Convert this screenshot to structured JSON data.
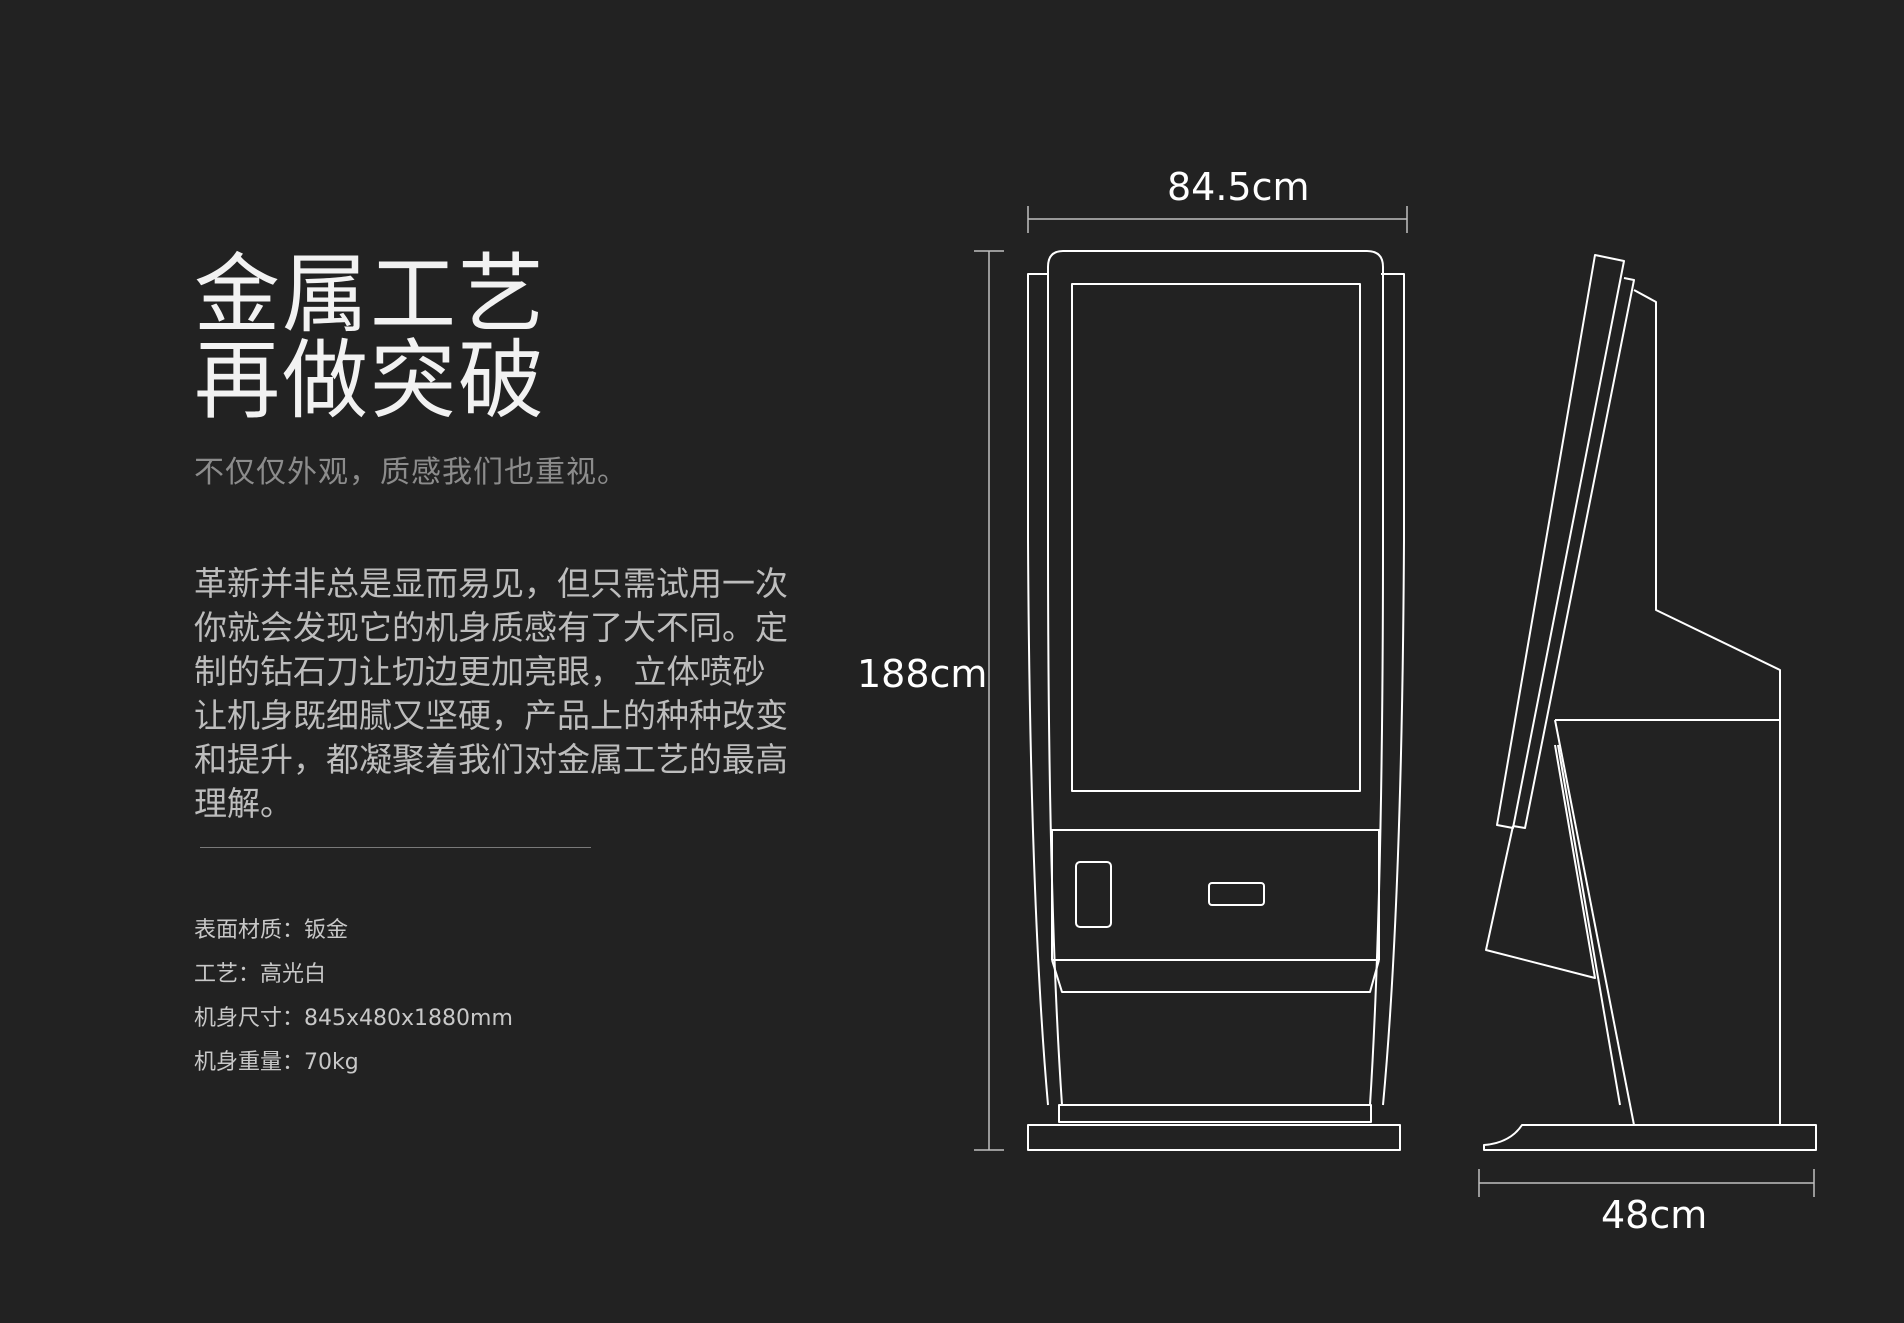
{
  "hero": {
    "title_line1": "金属工艺",
    "title_line2": "再做突破",
    "subtitle": "不仅仅外观，质感我们也重视。"
  },
  "description": {
    "lines": [
      "革新并非总是显而易见，但只需试用一次",
      "你就会发现它的机身质感有了大不同。定",
      "制的钻石刀让切边更加亮眼， 立体喷砂",
      "让机身既细腻又坚硬，产品上的种种改变",
      "和提升，都凝聚着我们对金属工艺的最高",
      "理解。"
    ]
  },
  "specs": [
    {
      "text": "表面材质：钣金"
    },
    {
      "text": "工艺：高光白"
    },
    {
      "text": "机身尺寸：845x480x1880mm"
    },
    {
      "text": "机身重量：70kg"
    }
  ],
  "dimensions": {
    "width": "84.5cm",
    "height": "188cm",
    "depth": "48cm"
  },
  "colors": {
    "background": "#222222",
    "line": "#ffffff",
    "dim_line": "#bfbfbf"
  }
}
